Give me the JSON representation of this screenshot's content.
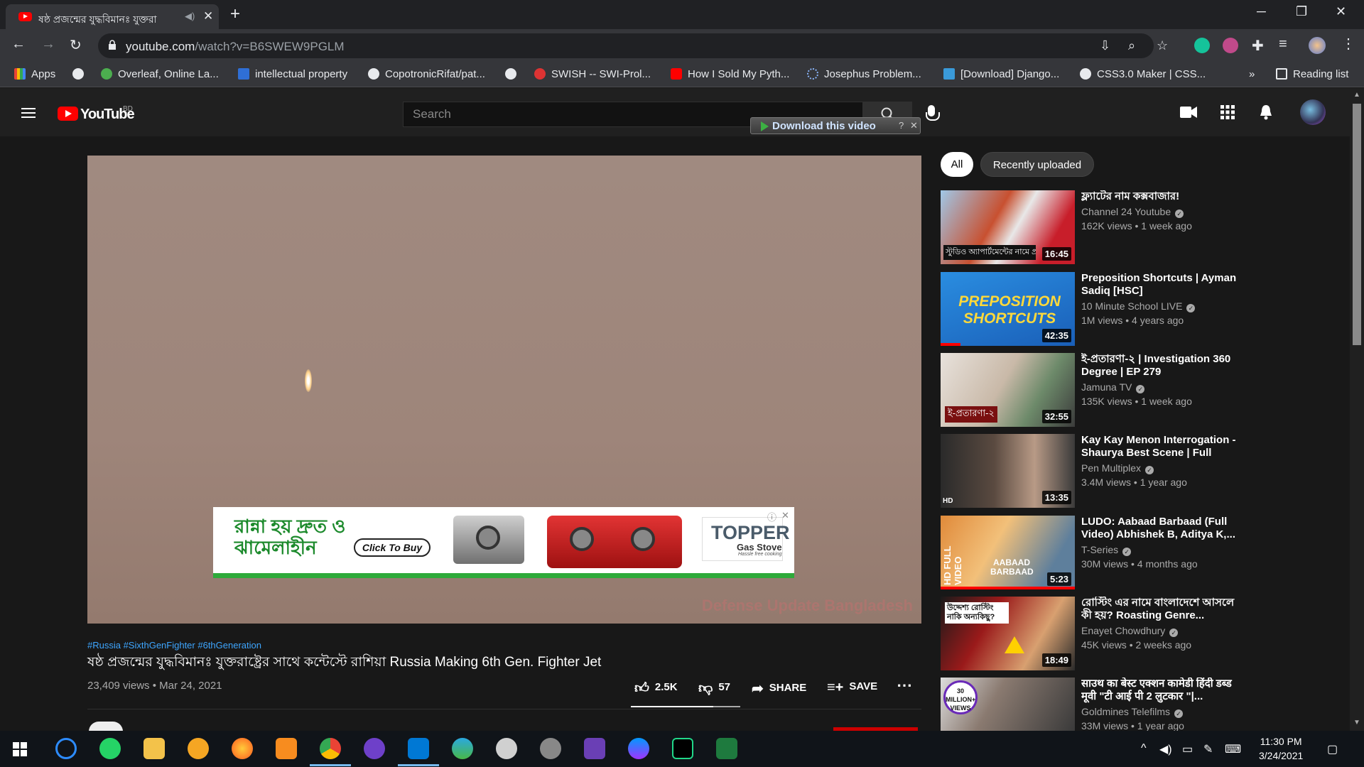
{
  "browser": {
    "tab_title": "ষষ্ঠ প্রজন্মের যুদ্ধবিমানঃ যুক্তরা",
    "url_host": "youtube.com",
    "url_path": "/watch?v=B6SWEW9PGLM",
    "bookmarks": [
      {
        "label": "Apps"
      },
      {
        "label": ""
      },
      {
        "label": "Overleaf, Online La..."
      },
      {
        "label": "intellectual property"
      },
      {
        "label": "CopotronicRifat/pat..."
      },
      {
        "label": ""
      },
      {
        "label": "SWISH -- SWI-Prol..."
      },
      {
        "label": "How I Sold My Pyth..."
      },
      {
        "label": "Josephus Problem..."
      },
      {
        "label": "[Download] Django..."
      },
      {
        "label": "CSS3.0 Maker | CSS..."
      }
    ],
    "bookmarks_overflow": "»",
    "reading_list": "Reading list"
  },
  "youtube": {
    "logo_text": "YouTube",
    "country": "BD",
    "search_placeholder": "Search",
    "download_label": "Download this video",
    "video": {
      "watermark": "Defense Update Bangladesh",
      "ad": {
        "headline": "রান্না হয় দ্রুত ও ঝামেলাহীন",
        "cta": "Click To Buy",
        "brand": "TOPPER",
        "brand_sub": "Gas Stove",
        "brand_tagline": "Hassle free cooking"
      },
      "tags": "#Russia #SixthGenFighter #6thGeneration",
      "title": "ষষ্ঠ প্রজন্মের যুদ্ধবিমানঃ যুক্তরাষ্ট্রের সাথে কন্টেস্টে রাশিয়া Russia Making 6th Gen. Fighter Jet",
      "views_date": "23,409 views • Mar 24, 2021",
      "likes": "2.5K",
      "dislikes": "57",
      "share": "SHARE",
      "save": "SAVE",
      "like_ratio": 0.75
    },
    "chips": [
      "All",
      "Recently uploaded"
    ],
    "recommendations": [
      {
        "title": "ফ্ল্যাটের নাম কক্সবাজার!",
        "channel": "Channel 24 Youtube",
        "meta": "162K views • 1 week ago",
        "duration": "16:45",
        "thumb_caption": "স্টুডিও অ্যাপার্টমেন্টের নামে প্রতারণা"
      },
      {
        "title": "Preposition Shortcuts | Ayman Sadiq [HSC]",
        "channel": "10 Minute School LIVE",
        "meta": "1M views • 4 years ago",
        "duration": "42:35",
        "thumb_caption": "PREPOSITION SHORTCUTS",
        "progress": 0.15
      },
      {
        "title": "ই-প্রতারণা-২ | Investigation 360 Degree | EP 279",
        "channel": "Jamuna TV",
        "meta": "135K views • 1 week ago",
        "duration": "32:55",
        "thumb_caption": "ই-প্রতারণা-২"
      },
      {
        "title": "Kay Kay Menon Interrogation - Shaurya Best Scene | Full Hind...",
        "channel": "Pen Multiplex",
        "meta": "3.4M views • 1 year ago",
        "duration": "13:35",
        "thumb_caption": "HD"
      },
      {
        "title": "LUDO: Aabaad Barbaad (Full Video) Abhishek B, Aditya K,...",
        "channel": "T-Series",
        "meta": "30M views • 4 months ago",
        "duration": "5:23",
        "thumb_caption": "AABAAD BARBAAD",
        "thumb_side": "HD FULL VIDEO",
        "progress": 1.0
      },
      {
        "title": "রোস্টিং এর নামে বাংলাদেশে আসলে কী হয়? Roasting Genre...",
        "channel": "Enayet Chowdhury",
        "meta": "45K views • 2 weeks ago",
        "duration": "18:49",
        "thumb_caption": "উদ্দেশ্য রোস্টিং নাকি অন্যকিছু?"
      },
      {
        "title": "साउथ का बेस्ट एक्शन कामेडी हिंदी डब्ड मूवी \"टी आई पी 2 लुटकार \"|...",
        "channel": "Goldmines Telefilms",
        "meta": "33M views • 1 year ago",
        "duration": "",
        "thumb_caption": "30 MILLION+ VIEWS"
      }
    ]
  },
  "taskbar": {
    "time": "11:30 PM",
    "date": "3/24/2021"
  },
  "colors": {
    "yt_red": "#ff0000",
    "link_blue": "#3ea6ff",
    "bg": "#181818",
    "header": "#202020"
  }
}
